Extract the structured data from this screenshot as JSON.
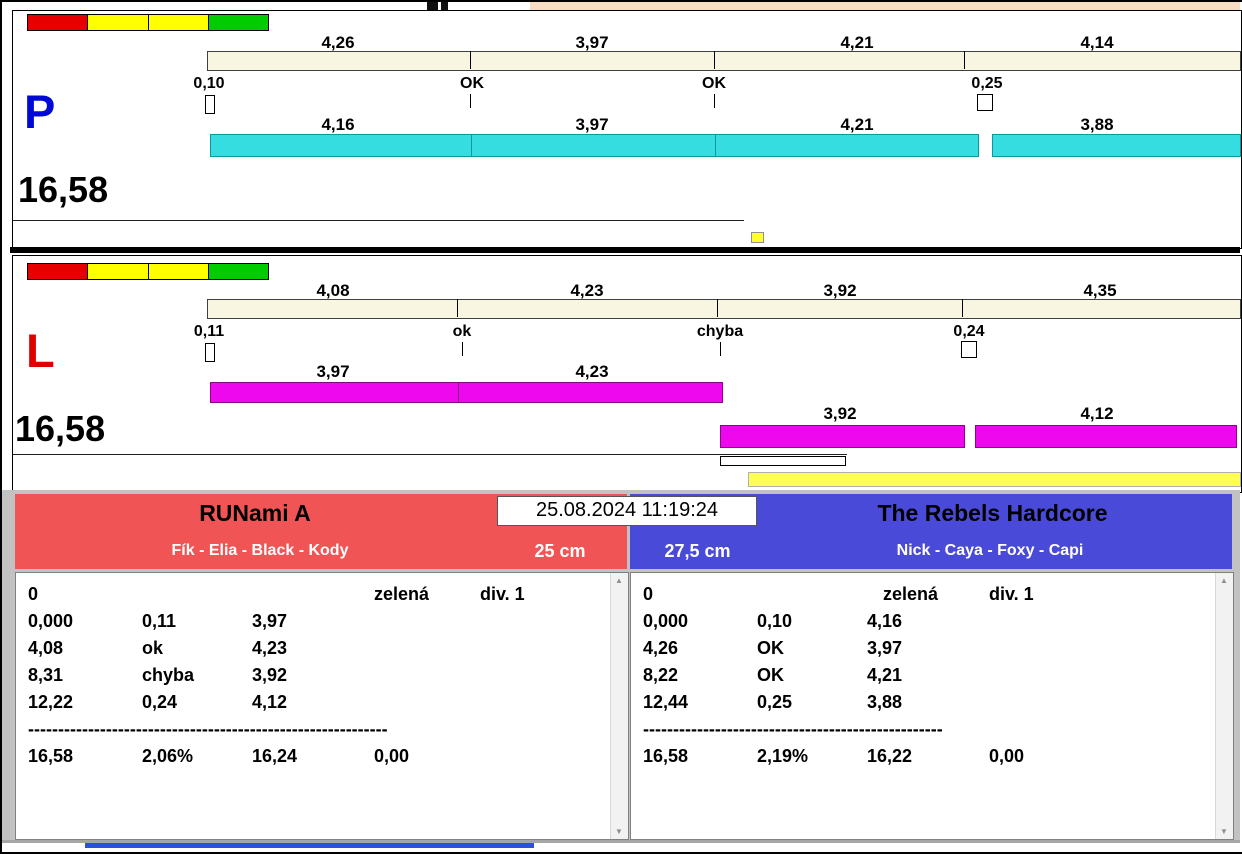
{
  "window": {
    "datetime": "25.08.2024 11:19:24"
  },
  "icons": {
    "up": "▲",
    "down": "▼"
  },
  "lane_p": {
    "letter": "P",
    "total": "16,58",
    "reference_splits": [
      "4,26",
      "3,97",
      "4,21",
      "4,14"
    ],
    "marks": [
      "0,10",
      "OK",
      "OK",
      "0,25"
    ],
    "run_splits": [
      "4,16",
      "3,97",
      "4,21",
      "3,88"
    ]
  },
  "lane_l": {
    "letter": "L",
    "total": "16,58",
    "reference_splits": [
      "4,08",
      "4,23",
      "3,92",
      "4,35"
    ],
    "marks": [
      "0,11",
      "ok",
      "chyba",
      "0,24"
    ],
    "run_splits_row1": [
      "3,97",
      "4,23"
    ],
    "run_splits_row2": [
      "3,92",
      "4,12"
    ]
  },
  "teams": {
    "left": {
      "name": "RUNami A",
      "dogs": "Fík - Elia - Black - Kody",
      "height": "25 cm",
      "rows": [
        [
          "0",
          "",
          "",
          "zelená",
          "div. 1"
        ],
        [
          "0,000",
          "0,11",
          "3,97",
          "",
          ""
        ],
        [
          "4,08",
          "ok",
          "4,23",
          "",
          ""
        ],
        [
          "8,31",
          "chyba",
          "3,92",
          "",
          ""
        ],
        [
          "12,22",
          "0,24",
          "4,12",
          "",
          ""
        ],
        [
          "------------------------------------------------------------",
          "",
          "",
          "",
          ""
        ],
        [
          "16,58",
          "2,06%",
          "16,24",
          "0,00",
          ""
        ]
      ]
    },
    "right": {
      "name": "The Rebels Hardcore",
      "dogs": "Nick - Caya - Foxy - Capi",
      "height": "27,5 cm",
      "rows": [
        [
          "0",
          "",
          "",
          "zelená",
          "div. 1"
        ],
        [
          "0,000",
          "0,10",
          "4,16",
          "",
          ""
        ],
        [
          "4,26",
          "OK",
          "3,97",
          "",
          ""
        ],
        [
          "8,22",
          "OK",
          "4,21",
          "",
          ""
        ],
        [
          "12,44",
          "0,25",
          "3,88",
          "",
          ""
        ],
        [
          "--------------------------------------------------",
          "",
          "",
          "",
          ""
        ],
        [
          "16,58",
          "2,19%",
          "16,22",
          "0,00",
          ""
        ]
      ]
    }
  },
  "colors": {
    "cream_bar": "#f8f6e0",
    "cyan_bar": "#35dce0",
    "magenta_bar": "#ee08ee",
    "yellow_bar": "#fdff56",
    "start_lights": [
      "#e60000",
      "#ffff00",
      "#ffff00",
      "#00cc00"
    ],
    "lane_p_letter": "#0008d7",
    "lane_l_letter": "#e00000",
    "team_left_header": "#f15454",
    "team_right_header": "#4a4ad8",
    "footer_bg": "#c2c2c2"
  }
}
